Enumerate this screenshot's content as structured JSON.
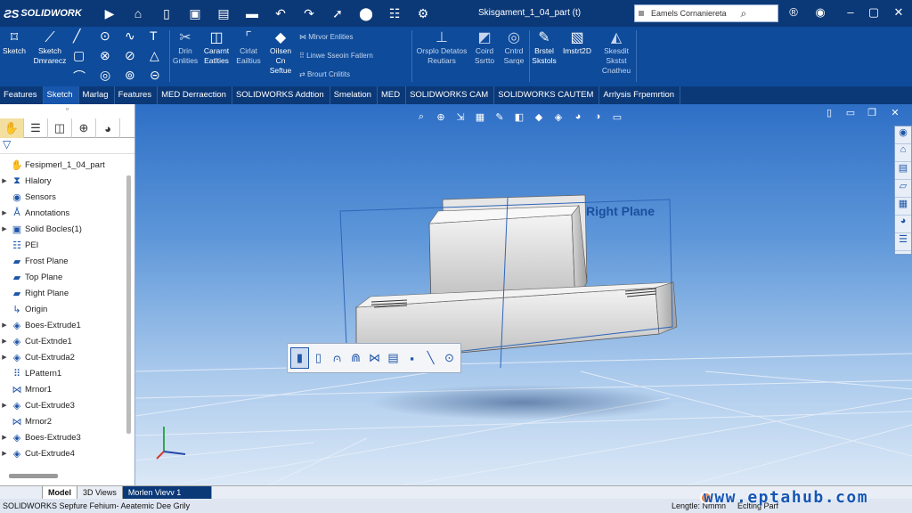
{
  "app": {
    "name": "SOLIDWORK"
  },
  "document": {
    "title": "Skisgament_1_04_part (t)"
  },
  "search": {
    "text": "Eamels Cornaniereta"
  },
  "ribbon": {
    "sketch": "Sketch",
    "sketch_dimension": [
      "Sketch",
      "Dmrarecz"
    ],
    "trim": [
      "Drin",
      "Gnlities"
    ],
    "convert": [
      "Cararnt",
      "Eatlties"
    ],
    "offset": [
      "Cirlat",
      "Eailtius"
    ],
    "offset_surface": [
      "Oilsen",
      "Cn",
      "Seftue"
    ],
    "mirror": "Mlrvor Enlities",
    "linear_pattern": "Linwe Sseoin Fatlern",
    "move": "Brourt Cnlitits",
    "display": [
      "Orsplo Detatos",
      "Reutiars"
    ],
    "repair": [
      "Coird",
      "Ssrtto"
    ],
    "quick_snaps": [
      "Cntrd",
      "Sarqe"
    ],
    "rapid_sketch": [
      "Brstel",
      "Skstols"
    ],
    "instant2d": "Imstrt2D",
    "shaded": [
      "Skesdit",
      "Skstst",
      "Cnatheu"
    ]
  },
  "command_tabs": [
    "Features",
    "Sketch",
    "Marlag",
    "Features",
    "MED Derraection",
    "SOLIDWORKS Addtion",
    "Smelation",
    "MED",
    "SOLIDWORKS CAM",
    "SOLIDWORKS CAUTEM",
    "Arrlysis Frpemrtion"
  ],
  "feature_tree": {
    "root": "Fesipmerl_1_04_part",
    "items": [
      "Hlalory",
      "Sensors",
      "Annotations",
      "Solid Bocles(1)",
      "PEI",
      "Frost Plane",
      "Top Plane",
      "Right Plane",
      "Origin",
      "Boes-Extrude1",
      "Cut-Extnde1",
      "Cut-Extruda2",
      "LPattern1",
      "Mrnor1",
      "Cut-Extrude3",
      "Mrnor2",
      "Boes-Extrude3",
      "Cut-Extrude4"
    ]
  },
  "viewport": {
    "plane_label": "Right Plane"
  },
  "bottom_tabs": [
    "Model",
    "3D Views",
    "Morlen Vievv 1"
  ],
  "status": {
    "left": "SOLIDWORKS Sepfure Fehium- Aeatemic Dee Grily",
    "right1": "Lengtle: Nmmn",
    "right2": "Eclting Parf"
  },
  "watermark": "www.eptahub.com"
}
